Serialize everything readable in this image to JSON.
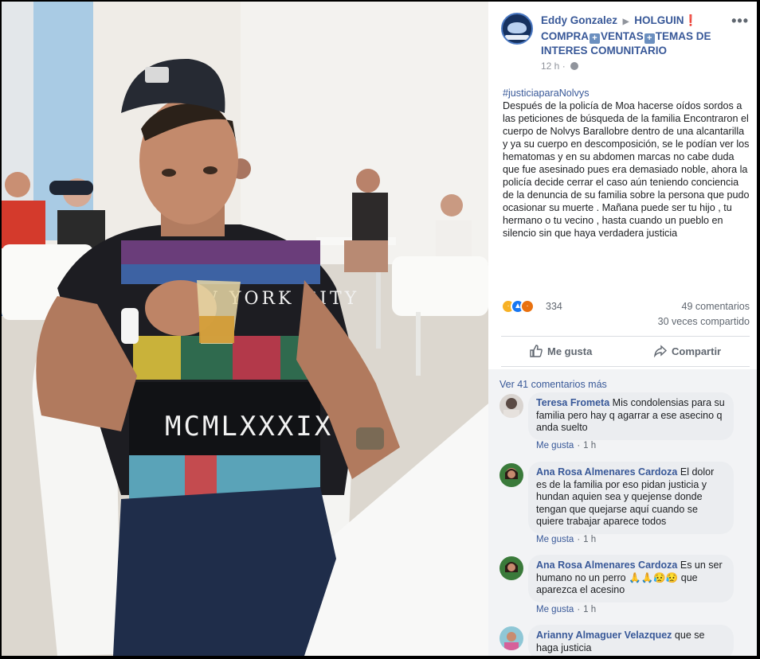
{
  "post": {
    "author": "Eddy Gonzalez",
    "group_name_line1": "HOLGUIN",
    "group_name_part2": "COMPRA",
    "group_name_part3": "VENTAS",
    "group_name_part4": "TEMAS DE INTERES COMUNITARIO",
    "time": "12 h",
    "hashtag": "#justiciaparaNolvys",
    "body": "Después de la policía de Moa hacerse oídos sordos a las peticiones de búsqueda de la familia Encontraron el cuerpo de Nolvys Barallobre dentro de una alcantarilla y ya su cuerpo en descomposición, se le podían ver los hematomas y en su abdomen marcas no cabe duda que fue asesinado pues era demasiado noble, ahora la policía decide cerrar el caso aún teniendo conciencia de la denuncia de su familia sobre la persona que pudo ocasionar su muerte . Mañana puede ser tu hijo , tu hermano o tu vecino , hasta cuando un pueblo en silencio sin que haya verdadera justicia"
  },
  "stats": {
    "reactions": "334",
    "comments": "49 comentarios",
    "shares": "30 veces compartido"
  },
  "actions": {
    "like": "Me gusta",
    "share": "Compartir"
  },
  "comments_section": {
    "more_link": "Ver 41 comentarios más",
    "items": [
      {
        "name": "Teresa Frometa",
        "text": "Mis condolensias para su familia pero hay q agarrar a ese asecino q anda suelto",
        "like": "Me gusta",
        "time": "1 h"
      },
      {
        "name": "Ana Rosa Almenares Cardoza",
        "text": "El dolor es de la familia por eso pidan justicia y hundan aquien sea y quejense donde tengan que quejarse aquí cuando se quiere trabajar aparece todos",
        "like": "Me gusta",
        "time": "1 h"
      },
      {
        "name": "Ana Rosa Almenares Cardoza",
        "text": "Es un ser humano no un perro 🙏🙏😥😥 que aparezca el acesino",
        "like": "Me gusta",
        "time": "1 h"
      },
      {
        "name": "Arianny Almaguer Velazquez",
        "text": "que se haga justicia"
      }
    ]
  },
  "photo": {
    "shirt_text_top": "NEW YORK CITY",
    "shirt_text_bottom": "MCMLXXXIX"
  },
  "colors": {
    "link": "#385898",
    "muted": "#606770",
    "comment_bg": "#f2f3f5",
    "bubble_bg": "#ebedf0"
  }
}
